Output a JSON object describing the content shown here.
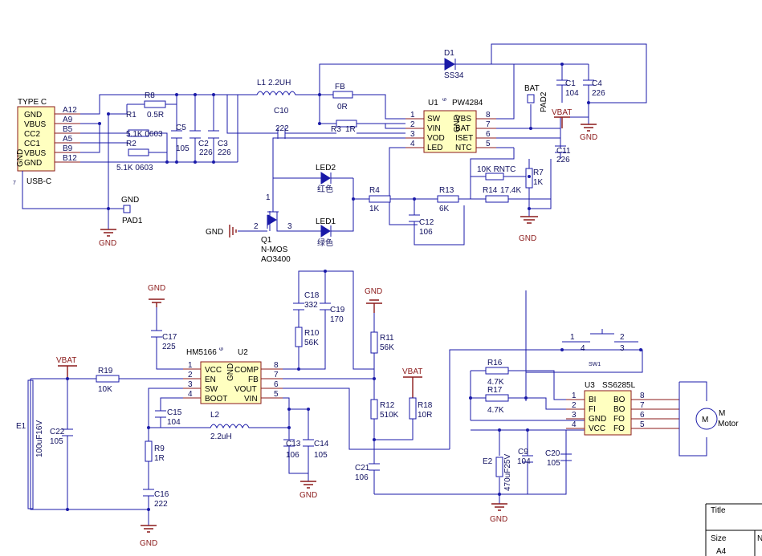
{
  "usb": {
    "title": "TYPE C",
    "footer": "USB-C",
    "ref_num": "7",
    "left_pins": [
      "GND",
      "VBUS",
      "CC2",
      "CC1",
      "VBUS",
      "GND"
    ],
    "right_pins": [
      "A12",
      "A9",
      "B5",
      "A5",
      "B9",
      "B12"
    ],
    "side_label": "GND"
  },
  "u1": {
    "ref": "U1",
    "part": "PW4284",
    "pin9": "9",
    "gnd_label": "GND",
    "left_pins": [
      "SW",
      "VIN",
      "VOD",
      "LED"
    ],
    "right_pins": [
      "VBS",
      "BAT",
      "ISET",
      "NTC"
    ],
    "left_nums": [
      "1",
      "2",
      "3",
      "4"
    ],
    "right_nums": [
      "8",
      "7",
      "6",
      "5"
    ]
  },
  "u2": {
    "ref": "U2",
    "part": "HM5166",
    "pin9": "9",
    "gnd_label": "GND",
    "left_pins": [
      "VCC",
      "EN",
      "SW",
      "BOOT"
    ],
    "right_pins": [
      "COMP",
      "FB",
      "VOUT",
      "VIN"
    ],
    "left_nums": [
      "1",
      "2",
      "3",
      "4"
    ],
    "right_nums": [
      "8",
      "7",
      "6",
      "5"
    ]
  },
  "u3": {
    "ref": "U3",
    "part": "SS6285L",
    "left_pins": [
      "BI",
      "FI",
      "GND",
      "VCC"
    ],
    "right_pins": [
      "BO",
      "BO",
      "FO",
      "FO"
    ],
    "left_nums": [
      "1",
      "2",
      "3",
      "4"
    ],
    "right_nums": [
      "8",
      "7",
      "6",
      "5"
    ]
  },
  "parts": {
    "r8": "R8",
    "r8v": "0.5R",
    "r1": "R1",
    "r1v": "5.1K 0603",
    "r2": "R2",
    "r2v": "5.1K 0603",
    "c5": "C5",
    "c5v": "105",
    "c2": "C2",
    "c2v": "226",
    "c3": "C3",
    "c3v": "226",
    "l1": "L1",
    "l1v": "2.2UH",
    "c10": "C10",
    "c10v": "222",
    "fb": "FB",
    "fbv": "0R",
    "r3": "R3",
    "r3v": "1R",
    "d1": "D1",
    "d1v": "SS34",
    "c1": "C1",
    "c1v": "104",
    "c4": "C4",
    "c4v": "226",
    "bat": "BAT",
    "pad2": "PAD2",
    "vbat": "VBAT",
    "c11": "C11",
    "c11v": "226",
    "rntc": "10K RNTC",
    "r7": "R7",
    "r7v": "1K",
    "r14": "R14",
    "r14v": "17.4K",
    "r13": "R13",
    "r13v": "6K",
    "r4": "R4",
    "r4v": "1K",
    "c12": "C12",
    "c12v": "106",
    "led2": "LED2",
    "led2c": "红色",
    "led1": "LED1",
    "led1c": "绿色",
    "q1": "Q1",
    "q1t": "N-MOS",
    "q1p": "AO3400",
    "q1pin1": "1",
    "q1pin2": "2",
    "q1pin3": "3",
    "pad1": "PAD1",
    "c18": "C18",
    "c18v": "332",
    "c19": "C19",
    "c19v": "170",
    "r10": "R10",
    "r10v": "56K",
    "c17": "C17",
    "c17v": "225",
    "r19": "R19",
    "r19v": "10K",
    "e1": "E1",
    "e1v": "100uF16V",
    "c22": "C22",
    "c22v": "105",
    "c15": "C15",
    "c15v": "104",
    "l2": "L2",
    "l2v": "2.2uH",
    "r9": "R9",
    "r9v": "1R",
    "c16": "C16",
    "c16v": "222",
    "c13": "C13",
    "c13v": "106",
    "c14": "C14",
    "c14v": "105",
    "r11": "R11",
    "r11v": "56K",
    "r12": "R12",
    "r12v": "510K",
    "r18": "R18",
    "r18v": "10R",
    "c21": "C21",
    "c21v": "106",
    "sw1": "SW1",
    "sw1a": "1",
    "sw1b": "2",
    "sw1c": "4",
    "sw1d": "3",
    "r16": "R16",
    "r16v": "4.7K",
    "r17": "R17",
    "r17v": "4.7K",
    "e2": "E2",
    "e2v": "470uF25V",
    "c9": "C9",
    "c9v": "104",
    "c20": "C20",
    "c20v": "105",
    "motor_m": "M",
    "motor": "Motor"
  },
  "gnd": "GND",
  "vbat": "VBAT",
  "title_block": {
    "title": "Title",
    "size": "Size",
    "size_val": "A4",
    "num": "N"
  }
}
